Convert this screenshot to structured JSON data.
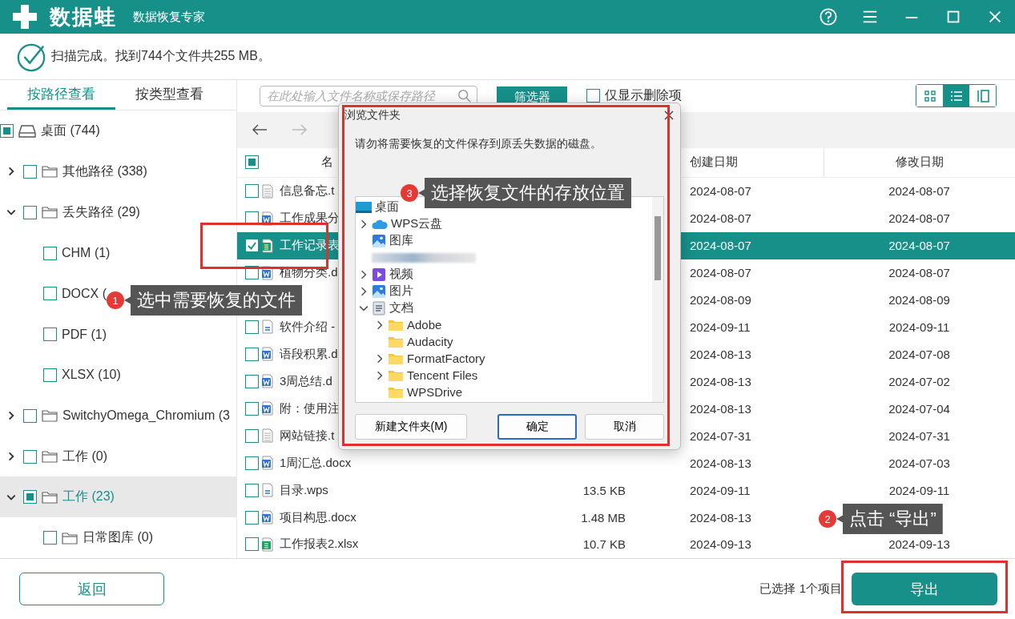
{
  "app": {
    "logo": "数据蛙",
    "subtitle": "数据恢复专家"
  },
  "status": "扫描完成。找到744个文件共255 MB。",
  "view_tabs": [
    {
      "label": "按路径查看",
      "selected": true
    },
    {
      "label": "按类型查看",
      "selected": false
    }
  ],
  "tree": [
    {
      "label": "桌面 (744)",
      "kind": "drive",
      "checked": false,
      "partial": true,
      "selected": false,
      "children": [
        {
          "label": "其他路径 (338)",
          "kind": "folder",
          "checked": false,
          "partial": false,
          "expanded": false,
          "selected": false
        },
        {
          "label": "丢失路径 (29)",
          "kind": "folder",
          "checked": false,
          "partial": false,
          "expanded": true,
          "selected": false,
          "children": [
            {
              "label": "CHM (1)",
              "kind": "type",
              "checked": false,
              "partial": false,
              "selected": false
            },
            {
              "label": "DOCX (",
              "kind": "type",
              "checked": false,
              "partial": false,
              "selected": false
            },
            {
              "label": "PDF (1)",
              "kind": "type",
              "checked": false,
              "partial": false,
              "selected": false
            },
            {
              "label": "XLSX (10)",
              "kind": "type",
              "checked": false,
              "partial": false,
              "selected": false
            }
          ]
        },
        {
          "label": "SwitchyOmega_Chromium (3",
          "kind": "folder",
          "checked": false,
          "partial": false,
          "expanded": false,
          "selected": false
        },
        {
          "label": "工作 (0)",
          "kind": "folder",
          "checked": false,
          "partial": false,
          "expanded": false,
          "selected": false
        },
        {
          "label": "工作 (23)",
          "kind": "folder",
          "checked": false,
          "partial": true,
          "expanded": true,
          "selected": true,
          "children": [
            {
              "label": "日常图库 (0)",
              "kind": "folder",
              "checked": false,
              "partial": false,
              "selected": false
            }
          ]
        }
      ]
    }
  ],
  "search": {
    "placeholder": "在此处输入文件名称或保存路径"
  },
  "filter_button": "筛选器",
  "deleted_only": {
    "label": "仅显示删除项",
    "checked": false
  },
  "view_modes": [
    {
      "kind": "grid",
      "selected": false
    },
    {
      "kind": "list",
      "selected": true
    },
    {
      "kind": "columns",
      "selected": false
    }
  ],
  "table": {
    "columns": [
      "名",
      "创建日期",
      "修改日期"
    ],
    "header": {
      "checked": false,
      "partial": true
    },
    "rows": [
      {
        "name": "信息备忘.t",
        "kind": "txt",
        "checked": false,
        "selected": false,
        "created": "2024-08-07",
        "modified": "2024-08-07"
      },
      {
        "name": "工作成果分",
        "kind": "word",
        "checked": false,
        "selected": false,
        "created": "2024-08-07",
        "modified": "2024-08-07"
      },
      {
        "name": "工作记录表",
        "kind": "sheet",
        "checked": true,
        "selected": true,
        "created": "2024-08-07",
        "modified": "2024-08-07"
      },
      {
        "name": "植物分类.d",
        "kind": "word",
        "checked": false,
        "selected": false,
        "created": "2024-08-07",
        "modified": "2024-08-07"
      },
      {
        "selected": false,
        "created": "2024-08-09",
        "modified": "2024-08-09"
      },
      {
        "name": "软件介绍 -",
        "kind": "wps",
        "checked": false,
        "selected": false,
        "created": "2024-09-11",
        "modified": "2024-09-11"
      },
      {
        "name": "语段积累.d",
        "kind": "word",
        "checked": false,
        "selected": false,
        "created": "2024-08-13",
        "modified": "2024-07-08"
      },
      {
        "name": "3周总结.d",
        "kind": "word",
        "checked": false,
        "selected": false,
        "created": "2024-08-13",
        "modified": "2024-07-02"
      },
      {
        "name": "附：使用注",
        "kind": "word",
        "checked": false,
        "selected": false,
        "created": "2024-08-13",
        "modified": "2024-07-04"
      },
      {
        "name": "网站链接.t",
        "kind": "txt",
        "checked": false,
        "selected": false,
        "created": "2024-07-31",
        "modified": "2024-07-31"
      },
      {
        "name": "1周汇总.docx",
        "kind": "word",
        "checked": false,
        "selected": false,
        "created": "2024-08-13",
        "modified": "2024-07-03"
      },
      {
        "name": "目录.wps",
        "kind": "wps",
        "checked": false,
        "selected": false,
        "size": "13.5 KB",
        "created": "2024-09-11",
        "modified": "2024-09-11"
      },
      {
        "name": "项目构思.docx",
        "kind": "word",
        "checked": false,
        "selected": false,
        "size": "1.48 MB",
        "created": "2024-08-13"
      },
      {
        "name": "工作报表2.xlsx",
        "kind": "sheet",
        "checked": false,
        "selected": false,
        "size": "10.7 KB",
        "created": "2024-09-13",
        "modified": "2024-09-13"
      }
    ]
  },
  "dialog": {
    "title": "浏览文件夹",
    "message": "请勿将需要恢复的文件保存到原丢失数据的磁盘。",
    "tree": [
      {
        "label": "桌面",
        "kind": "desktop",
        "children": [
          {
            "label": "WPS云盘",
            "kind": "cloud",
            "expanded": false
          },
          {
            "label": "图库",
            "kind": "gallery"
          },
          {
            "kind": "redacted"
          },
          {
            "label": "视频",
            "kind": "video",
            "expanded": false
          },
          {
            "label": "图片",
            "kind": "pictures",
            "expanded": false
          },
          {
            "label": "文档",
            "kind": "documents",
            "expanded": true,
            "children": [
              {
                "label": "Adobe",
                "kind": "folder",
                "expanded": false
              },
              {
                "label": "Audacity",
                "kind": "folder"
              },
              {
                "label": "FormatFactory",
                "kind": "folder",
                "expanded": false
              },
              {
                "label": "Tencent Files",
                "kind": "folder",
                "expanded": false
              },
              {
                "label": "WPSDrive",
                "kind": "folder"
              }
            ]
          }
        ]
      }
    ],
    "buttons": [
      {
        "label": "新建文件夹(M)",
        "focused": false
      },
      {
        "label": "确定",
        "focused": true
      },
      {
        "label": "取消",
        "focused": false
      }
    ]
  },
  "footer": {
    "back": "返回",
    "selection": "已选择 1个项目",
    "export": "导出"
  },
  "callouts": [
    {
      "number": "1",
      "text": "选中需要恢复的文件"
    },
    {
      "number": "3",
      "text": "选择恢复文件的存放位置"
    },
    {
      "number": "2",
      "text": "点击 “导出”"
    }
  ]
}
